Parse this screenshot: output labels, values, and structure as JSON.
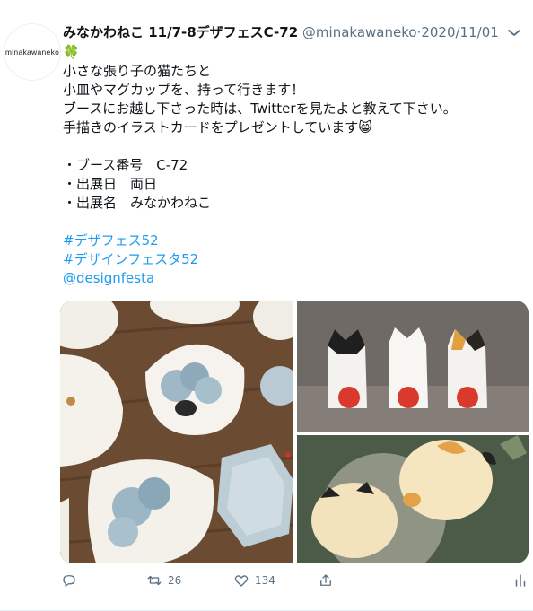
{
  "tweet": {
    "avatar_text": "minakawaneko",
    "display_name": "みなかわねこ 11/7-8デザフェスC-72",
    "handle": "@minakawaneko",
    "separator": "·",
    "date": "2020/11/01",
    "lines": [
      "🍀",
      "小さな張り子の猫たちと",
      "小皿やマグカップを、持って行きます！",
      "ブースにお越し下さった時は、Twitterを見たよと教えて下さい。",
      "手描きのイラストカードをプレゼントしています😸",
      "",
      "・ブース番号　C-72",
      "・出展日　両日",
      "・出展名　みなかわねこ",
      ""
    ],
    "links": [
      "#デザフェス52",
      "#デザインフェスタ52",
      "@designfesta"
    ]
  },
  "actions": {
    "reply_count": "",
    "retweet_count": "26",
    "like_count": "134"
  },
  "colors": {
    "accent": "#1d9bf0",
    "secondary_text": "#5b7083"
  },
  "icons": [
    "more-icon",
    "reply-icon",
    "retweet-icon",
    "like-icon",
    "share-icon",
    "analytics-icon"
  ]
}
